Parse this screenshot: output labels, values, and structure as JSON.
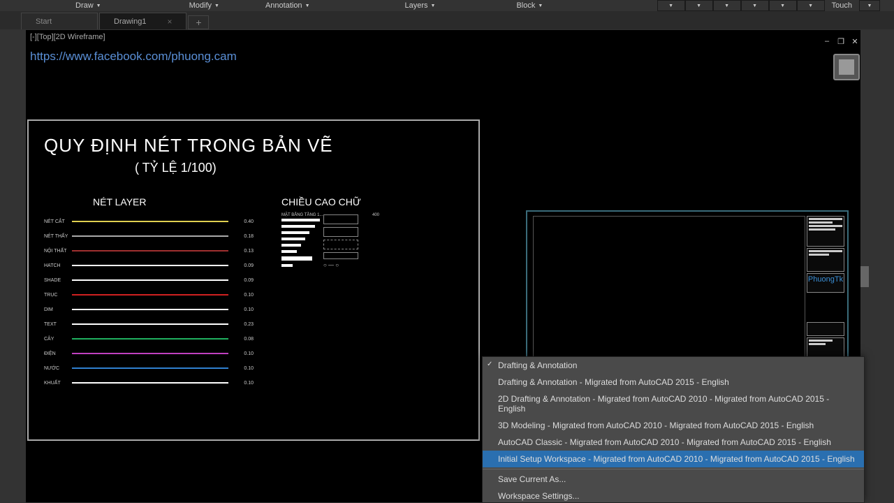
{
  "menu": {
    "draw": "Draw",
    "modify": "Modify",
    "annotation": "Annotation",
    "layers": "Layers",
    "block": "Block",
    "touch": "Touch"
  },
  "tabs": {
    "start": "Start",
    "drawing1": "Drawing1"
  },
  "view_label": "[-][Top][2D Wireframe]",
  "url": "https://www.facebook.com/phuong.cam",
  "drawing": {
    "title": "QUY ĐỊNH NÉT TRONG BẢN VẼ",
    "subtitle": "( TỶ LỆ 1/100)",
    "layer_heading": "NÉT LAYER",
    "text_heading": "CHIỀU CAO CHỮ",
    "layers": [
      {
        "name": "NÉT CẮT",
        "color": "#e0d050",
        "val": "0.40"
      },
      {
        "name": "NÉT THẤY",
        "color": "#aaaaaa",
        "val": "0.18"
      },
      {
        "name": "NỘI THẤT",
        "color": "#a03030",
        "val": "0.13"
      },
      {
        "name": "HATCH",
        "color": "#ffffff",
        "val": "0.09"
      },
      {
        "name": "SHADE",
        "color": "#ffffff",
        "val": "0.09"
      },
      {
        "name": "TRỤC",
        "color": "#d02020",
        "val": "0.10"
      },
      {
        "name": "DIM",
        "color": "#ffffff",
        "val": "0.10"
      },
      {
        "name": "TEXT",
        "color": "#ffffff",
        "val": "0.23"
      },
      {
        "name": "CÂY",
        "color": "#20b060",
        "val": "0.08"
      },
      {
        "name": "ĐIỆN",
        "color": "#c040c0",
        "val": "0.10"
      },
      {
        "name": "NƯỚC",
        "color": "#3080d0",
        "val": "0.10"
      },
      {
        "name": "KHUẤT",
        "color": "#ffffff",
        "val": "0.10"
      }
    ],
    "text_sample_label": "MẶT BẰNG TẦNG 1...",
    "text_sample_val": "400"
  },
  "preview_brand": "PhuongTk",
  "workspace_menu": {
    "items": [
      {
        "label": "Drafting & Annotation",
        "checked": true,
        "hl": false
      },
      {
        "label": "Drafting & Annotation - Migrated from AutoCAD 2015 - English",
        "checked": false,
        "hl": false
      },
      {
        "label": "2D Drafting & Annotation - Migrated from AutoCAD 2010 - Migrated from AutoCAD 2015 - English",
        "checked": false,
        "hl": false
      },
      {
        "label": "3D Modeling - Migrated from AutoCAD 2010 - Migrated from AutoCAD 2015 - English",
        "checked": false,
        "hl": false
      },
      {
        "label": "AutoCAD Classic - Migrated from AutoCAD 2010 - Migrated from AutoCAD 2015 - English",
        "checked": false,
        "hl": false
      },
      {
        "label": "Initial Setup Workspace - Migrated from AutoCAD 2010 - Migrated from AutoCAD 2015 - English",
        "checked": false,
        "hl": true
      }
    ],
    "save_as": "Save Current As...",
    "settings": "Workspace Settings..."
  }
}
